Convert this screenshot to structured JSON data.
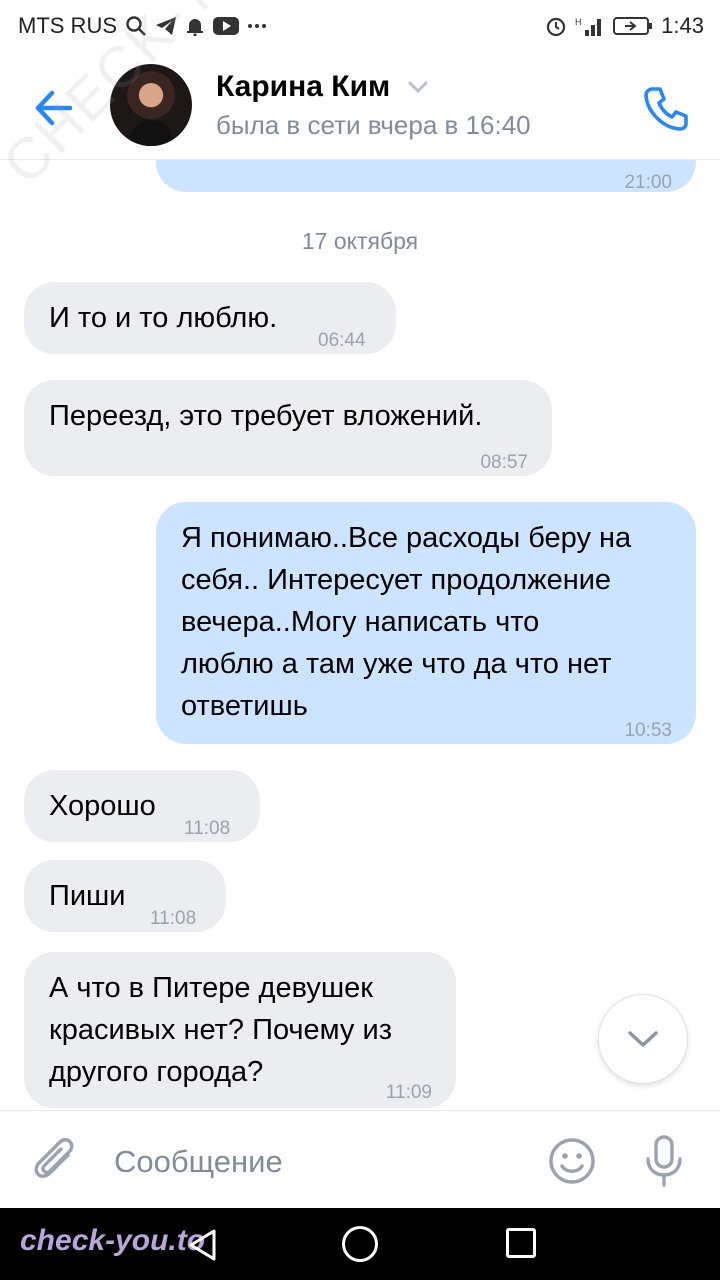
{
  "status_bar": {
    "carrier": "MTS RUS",
    "time": "1:43"
  },
  "header": {
    "name": "Карина Ким",
    "status": "была в сети вчера в 16:40"
  },
  "messages": {
    "prev_time": "21:00",
    "date_separator": "17 октября",
    "m1": {
      "text": "И то и то люблю.",
      "time": "06:44"
    },
    "m2": {
      "text": "Переезд, это требует вложений.",
      "time": "08:57"
    },
    "m3": {
      "text": "Я понимаю..Все расходы беру на\nсебя.. Интересует продолжение\nвечера..Могу написать что\nлюблю а там уже что да что нет\nответишь",
      "time": "10:53"
    },
    "m4": {
      "text": "Хорошо",
      "time": "11:08"
    },
    "m5": {
      "text": "Пиши",
      "time": "11:08"
    },
    "m6": {
      "text": "А что в Питере девушек\nкрасивых нет? Почему из\nдругого города?",
      "time": "11:09"
    }
  },
  "composer": {
    "placeholder": "Сообщение"
  },
  "watermarks": {
    "diagonal": "CHECK-YOU.ME",
    "site": "check-you.to"
  },
  "icons": {
    "back": "arrow-left-icon",
    "call": "phone-icon",
    "attach": "paperclip-icon",
    "emoji": "smile-icon",
    "mic": "microphone-icon",
    "scroll": "chevron-down-icon"
  },
  "colors": {
    "accent": "#2787f5",
    "incoming": "#ebedf0",
    "outgoing": "#cce4ff",
    "muted": "#818c99"
  }
}
